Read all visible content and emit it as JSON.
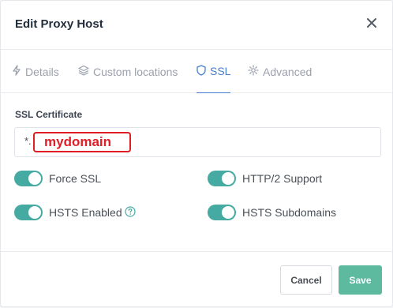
{
  "dialog": {
    "title": "Edit Proxy Host",
    "close_icon": "close-icon"
  },
  "tabs": [
    {
      "label": "Details",
      "icon": "bolt-icon",
      "active": false
    },
    {
      "label": "Custom locations",
      "icon": "layers-icon",
      "active": false
    },
    {
      "label": "SSL",
      "icon": "shield-icon",
      "active": true
    },
    {
      "label": "Advanced",
      "icon": "gear-icon",
      "active": false
    }
  ],
  "ssl": {
    "section_label": "SSL Certificate",
    "certificate_prefix": "*.",
    "certificate_domain": "mydomain"
  },
  "toggles": [
    {
      "label": "Force SSL",
      "enabled": true
    },
    {
      "label": "HTTP/2 Support",
      "enabled": true
    },
    {
      "label": "HSTS Enabled",
      "enabled": true,
      "has_help": true
    },
    {
      "label": "HSTS Subdomains",
      "enabled": true
    }
  ],
  "footer": {
    "cancel_label": "Cancel",
    "save_label": "Save"
  },
  "colors": {
    "accent_blue": "#467fcf",
    "toggle_teal": "#45aaa2",
    "save_green": "#5eba9f",
    "highlight_red": "#e11d26"
  }
}
